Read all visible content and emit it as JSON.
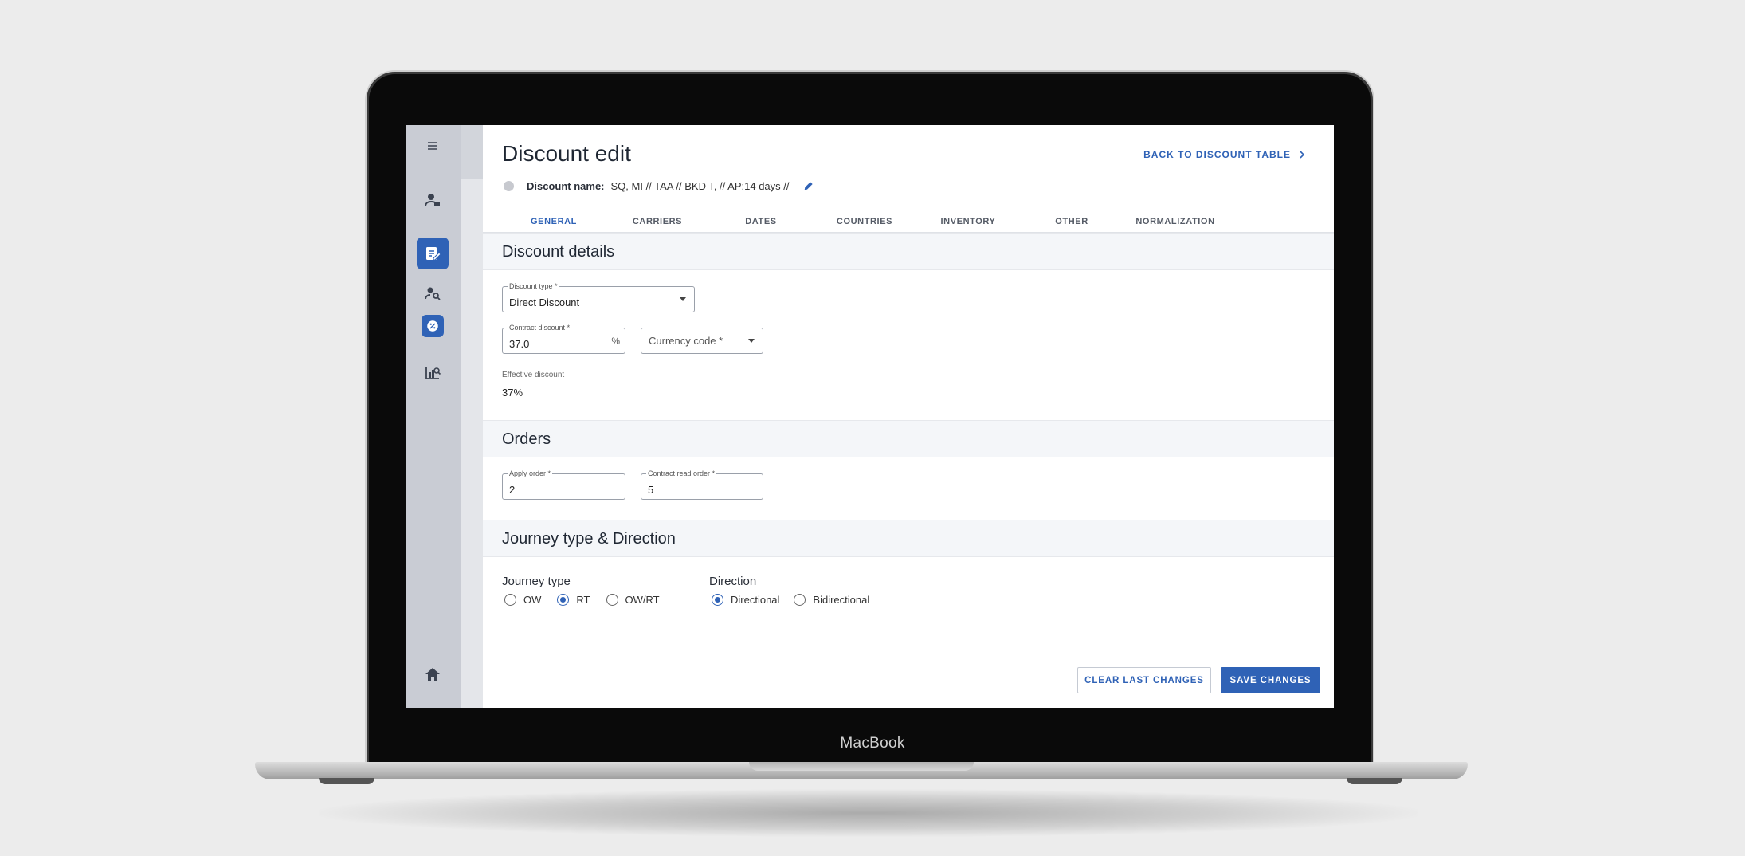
{
  "device": {
    "brand": "MacBook"
  },
  "sidebar": {
    "items": [
      {
        "icon": "menu-icon"
      },
      {
        "icon": "user-settings-icon"
      },
      {
        "icon": "discount-edit-icon",
        "active": true
      },
      {
        "icon": "user-search-icon"
      },
      {
        "icon": "badge-percent-icon",
        "active": true
      },
      {
        "icon": "reports-icon"
      },
      {
        "icon": "home-icon"
      }
    ]
  },
  "header": {
    "title": "Discount edit",
    "back_link": "BACK TO DISCOUNT TABLE",
    "discount_name_label": "Discount name:",
    "discount_name_value": "SQ, MI // TAA // BKD T, // AP:14 days //"
  },
  "tabs": [
    {
      "label": "GENERAL",
      "active": true
    },
    {
      "label": "CARRIERS"
    },
    {
      "label": "DATES"
    },
    {
      "label": "COUNTRIES"
    },
    {
      "label": "INVENTORY"
    },
    {
      "label": "OTHER"
    },
    {
      "label": "NORMALIZATION"
    }
  ],
  "discount_details": {
    "heading": "Discount details",
    "discount_type": {
      "label": "Discount type",
      "required": "*",
      "value": "Direct Discount"
    },
    "contract_discount": {
      "label": "Contract discount",
      "required": "*",
      "value": "37.0",
      "suffix": "%"
    },
    "currency_code": {
      "placeholder": "Currency code",
      "required": "*"
    },
    "effective_discount": {
      "label": "Effective discount",
      "value": "37%"
    }
  },
  "orders": {
    "heading": "Orders",
    "apply_order": {
      "label": "Apply order",
      "required": "*",
      "value": "2"
    },
    "contract_read_order": {
      "label": "Contract read order",
      "required": "*",
      "value": "5"
    }
  },
  "journey": {
    "heading": "Journey type & Direction",
    "journey_type": {
      "label": "Journey type",
      "options": [
        {
          "label": "OW",
          "selected": false
        },
        {
          "label": "RT",
          "selected": true
        },
        {
          "label": "OW/RT",
          "selected": false
        }
      ]
    },
    "direction": {
      "label": "Direction",
      "options": [
        {
          "label": "Directional",
          "selected": true
        },
        {
          "label": "Bidirectional",
          "selected": false
        }
      ]
    }
  },
  "actions": {
    "clear_label": "CLEAR LAST CHANGES",
    "save_label": "SAVE CHANGES"
  },
  "colors": {
    "accent": "#2f62b6",
    "sidebar": "#c9ccd4",
    "section_bg": "#f4f6f9"
  }
}
